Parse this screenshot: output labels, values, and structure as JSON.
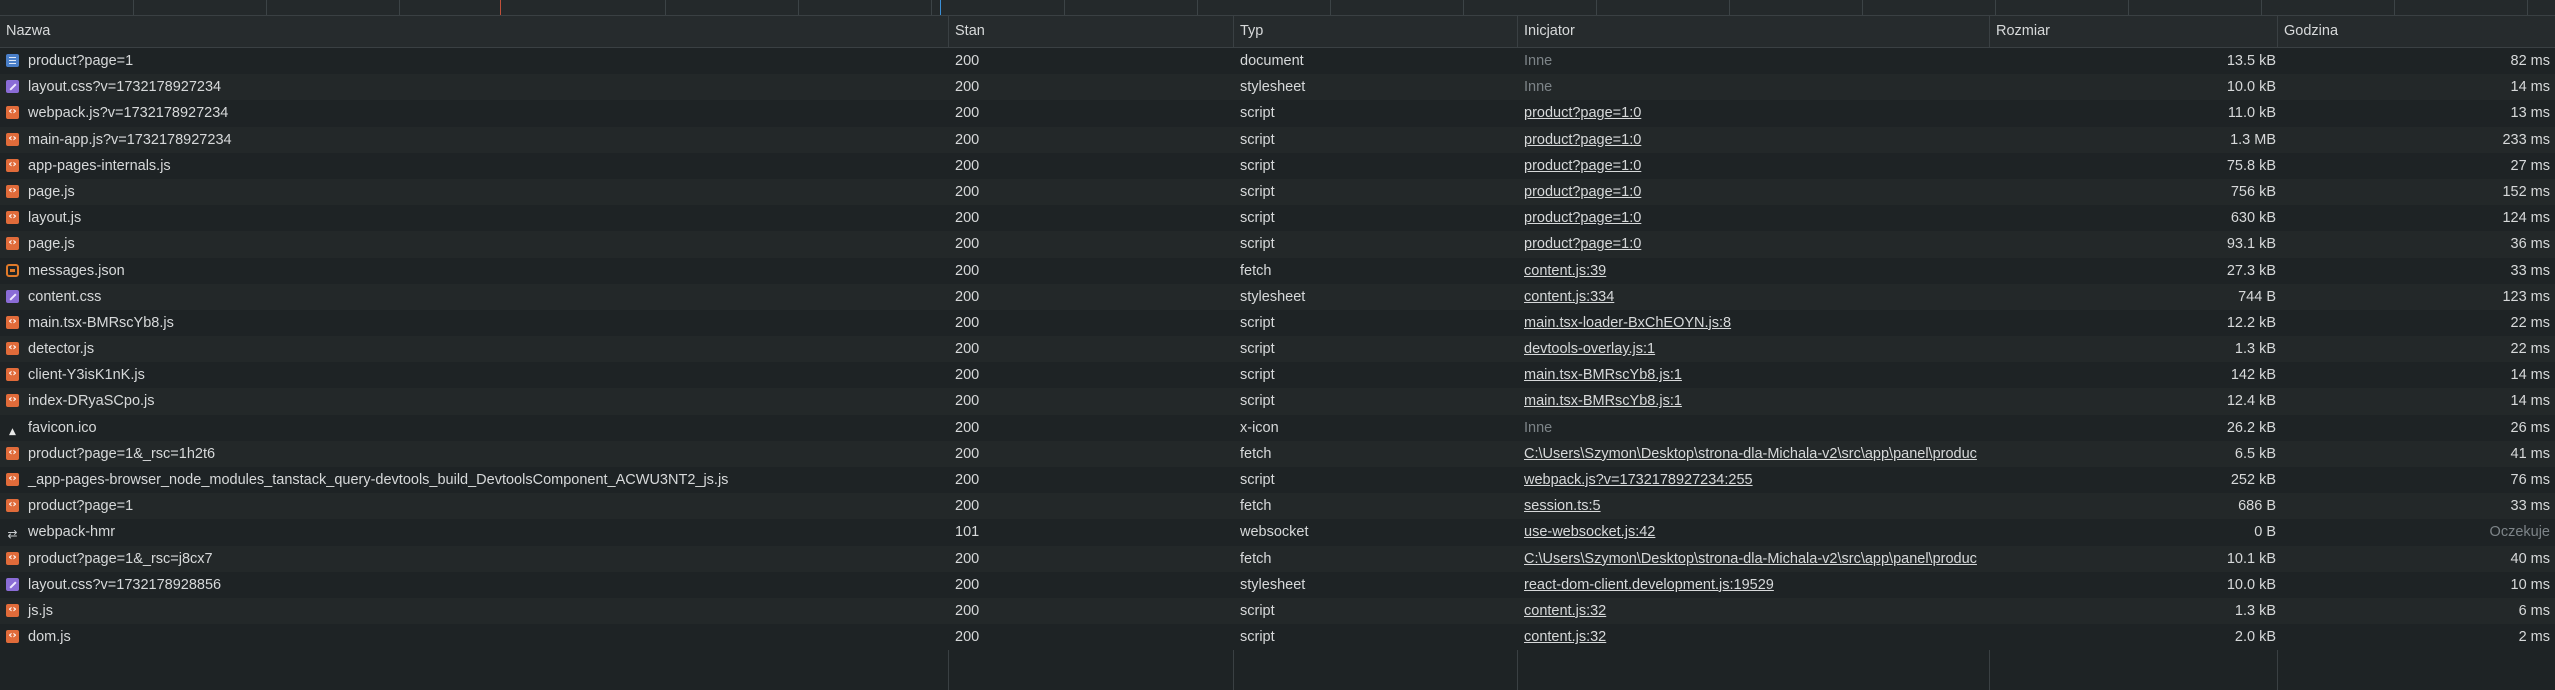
{
  "columns": {
    "name": "Nazwa",
    "status": "Stan",
    "type": "Typ",
    "initiator": "Inicjator",
    "size": "Rozmiar",
    "time": "Godzina"
  },
  "rows": [
    {
      "icon": "document-icon",
      "kind": "doc",
      "name": "product?page=1",
      "status": "200",
      "type": "document",
      "initiator": "Inne",
      "initiator_link": false,
      "size": "13.5 kB",
      "time": "82 ms"
    },
    {
      "icon": "stylesheet-icon",
      "kind": "css",
      "name": "layout.css?v=1732178927234",
      "status": "200",
      "type": "stylesheet",
      "initiator": "Inne",
      "initiator_link": false,
      "size": "10.0 kB",
      "time": "14 ms"
    },
    {
      "icon": "script-icon",
      "kind": "js",
      "name": "webpack.js?v=1732178927234",
      "status": "200",
      "type": "script",
      "initiator": "product?page=1:0",
      "initiator_link": true,
      "size": "11.0 kB",
      "time": "13 ms"
    },
    {
      "icon": "script-icon",
      "kind": "js",
      "name": "main-app.js?v=1732178927234",
      "status": "200",
      "type": "script",
      "initiator": "product?page=1:0",
      "initiator_link": true,
      "size": "1.3 MB",
      "time": "233 ms"
    },
    {
      "icon": "script-icon",
      "kind": "js",
      "name": "app-pages-internals.js",
      "status": "200",
      "type": "script",
      "initiator": "product?page=1:0",
      "initiator_link": true,
      "size": "75.8 kB",
      "time": "27 ms"
    },
    {
      "icon": "script-icon",
      "kind": "js",
      "name": "page.js",
      "status": "200",
      "type": "script",
      "initiator": "product?page=1:0",
      "initiator_link": true,
      "size": "756 kB",
      "time": "152 ms"
    },
    {
      "icon": "script-icon",
      "kind": "js",
      "name": "layout.js",
      "status": "200",
      "type": "script",
      "initiator": "product?page=1:0",
      "initiator_link": true,
      "size": "630 kB",
      "time": "124 ms"
    },
    {
      "icon": "script-icon",
      "kind": "js",
      "name": "page.js",
      "status": "200",
      "type": "script",
      "initiator": "product?page=1:0",
      "initiator_link": true,
      "size": "93.1 kB",
      "time": "36 ms"
    },
    {
      "icon": "fetch-icon",
      "kind": "fetch",
      "name": "messages.json",
      "status": "200",
      "type": "fetch",
      "initiator": "content.js:39",
      "initiator_link": true,
      "size": "27.3 kB",
      "time": "33 ms"
    },
    {
      "icon": "stylesheet-icon",
      "kind": "css",
      "name": "content.css",
      "status": "200",
      "type": "stylesheet",
      "initiator": "content.js:334",
      "initiator_link": true,
      "size": "744 B",
      "time": "123 ms"
    },
    {
      "icon": "script-icon",
      "kind": "js",
      "name": "main.tsx-BMRscYb8.js",
      "status": "200",
      "type": "script",
      "initiator": "main.tsx-loader-BxChEOYN.js:8",
      "initiator_link": true,
      "size": "12.2 kB",
      "time": "22 ms"
    },
    {
      "icon": "script-icon",
      "kind": "js",
      "name": "detector.js",
      "status": "200",
      "type": "script",
      "initiator": "devtools-overlay.js:1",
      "initiator_link": true,
      "size": "1.3 kB",
      "time": "22 ms"
    },
    {
      "icon": "script-icon",
      "kind": "js",
      "name": "client-Y3isK1nK.js",
      "status": "200",
      "type": "script",
      "initiator": "main.tsx-BMRscYb8.js:1",
      "initiator_link": true,
      "size": "142 kB",
      "time": "14 ms"
    },
    {
      "icon": "script-icon",
      "kind": "js",
      "name": "index-DRyaSCpo.js",
      "status": "200",
      "type": "script",
      "initiator": "main.tsx-BMRscYb8.js:1",
      "initiator_link": true,
      "size": "12.4 kB",
      "time": "14 ms"
    },
    {
      "icon": "favicon-icon",
      "kind": "favicon",
      "name": "favicon.ico",
      "status": "200",
      "type": "x-icon",
      "initiator": "Inne",
      "initiator_link": false,
      "size": "26.2 kB",
      "time": "26 ms"
    },
    {
      "icon": "script-icon",
      "kind": "js",
      "name": "product?page=1&_rsc=1h2t6",
      "status": "200",
      "type": "fetch",
      "initiator": "C:\\Users\\Szymon\\Desktop\\strona-dla-Michala-v2\\src\\app\\panel\\produc",
      "initiator_link": true,
      "size": "6.5 kB",
      "time": "41 ms"
    },
    {
      "icon": "script-icon",
      "kind": "js",
      "name": "_app-pages-browser_node_modules_tanstack_query-devtools_build_DevtoolsComponent_ACWU3NT2_js.js",
      "status": "200",
      "type": "script",
      "initiator": "webpack.js?v=1732178927234:255",
      "initiator_link": true,
      "size": "252 kB",
      "time": "76 ms"
    },
    {
      "icon": "script-icon",
      "kind": "js",
      "name": "product?page=1",
      "status": "200",
      "type": "fetch",
      "initiator": "session.ts:5",
      "initiator_link": true,
      "size": "686 B",
      "time": "33 ms"
    },
    {
      "icon": "websocket-icon",
      "kind": "ws",
      "name": "webpack-hmr",
      "status": "101",
      "type": "websocket",
      "initiator": "use-websocket.js:42",
      "initiator_link": true,
      "size": "0 B",
      "time": "Oczekuje",
      "time_muted": true
    },
    {
      "icon": "script-icon",
      "kind": "js",
      "name": "product?page=1&_rsc=j8cx7",
      "status": "200",
      "type": "fetch",
      "initiator": "C:\\Users\\Szymon\\Desktop\\strona-dla-Michala-v2\\src\\app\\panel\\produc",
      "initiator_link": true,
      "size": "10.1 kB",
      "time": "40 ms"
    },
    {
      "icon": "stylesheet-icon",
      "kind": "css",
      "name": "layout.css?v=1732178928856",
      "status": "200",
      "type": "stylesheet",
      "initiator": "react-dom-client.development.js:19529",
      "initiator_link": true,
      "size": "10.0 kB",
      "time": "10 ms"
    },
    {
      "icon": "script-icon",
      "kind": "js",
      "name": "js.js",
      "status": "200",
      "type": "script",
      "initiator": "content.js:32",
      "initiator_link": true,
      "size": "1.3 kB",
      "time": "6 ms"
    },
    {
      "icon": "script-icon",
      "kind": "js",
      "name": "dom.js",
      "status": "200",
      "type": "script",
      "initiator": "content.js:32",
      "initiator_link": true,
      "size": "2.0 kB",
      "time": "2 ms"
    }
  ]
}
